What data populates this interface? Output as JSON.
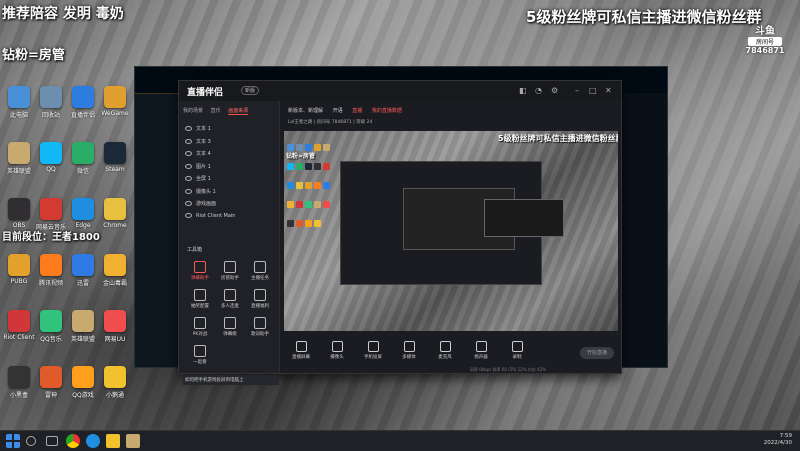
{
  "overlay": {
    "top_left": "推荐陪容 发明 毒奶",
    "left_mid": "钻粉=房管",
    "left_low": "目前段位：王者1800",
    "top_right": "5级粉丝牌可私信主播进微信粉丝群"
  },
  "room_badge": {
    "site": "斗鱼",
    "label": "房间号",
    "room": "7846871"
  },
  "desktop_icons": [
    {
      "label": "此电脑",
      "color": "#4a90d9"
    },
    {
      "label": "回收站",
      "color": "#6c8fb0"
    },
    {
      "label": "直播伴侣",
      "color": "#2d7de0"
    },
    {
      "label": "WeGame",
      "color": "#e0a030"
    },
    {
      "label": "英雄联盟",
      "color": "#c8aa6e"
    },
    {
      "label": "QQ",
      "color": "#12b7f5"
    },
    {
      "label": "微信",
      "color": "#2aae67"
    },
    {
      "label": "Steam",
      "color": "#1b2838"
    },
    {
      "label": "OBS",
      "color": "#302e31"
    },
    {
      "label": "网易云音乐",
      "color": "#d33a31"
    },
    {
      "label": "Edge",
      "color": "#1f8de0"
    },
    {
      "label": "Chrome",
      "color": "#e8c040"
    },
    {
      "label": "PUBG",
      "color": "#e3a02c"
    },
    {
      "label": "腾讯视频",
      "color": "#ff7c1e"
    },
    {
      "label": "迅雷",
      "color": "#2f7ae5"
    },
    {
      "label": "金山毒霸",
      "color": "#f0b030"
    },
    {
      "label": "Riot Client",
      "color": "#d13639"
    },
    {
      "label": "QQ音乐",
      "color": "#31c27c"
    },
    {
      "label": "英雄联盟",
      "color": "#c8aa6e"
    },
    {
      "label": "网易UU",
      "color": "#f04e4e"
    },
    {
      "label": "小黑盒",
      "color": "#333333"
    },
    {
      "label": "雷神",
      "color": "#e05a2a"
    },
    {
      "label": "QQ游戏",
      "color": "#ff9f1c"
    },
    {
      "label": "小鹅通",
      "color": "#f2c12e"
    }
  ],
  "app": {
    "title": "直播伴侣",
    "badge": "新版",
    "left_tabs": [
      "我的场景",
      "直乐",
      "画面来源"
    ],
    "sources": [
      "文本 1",
      "文本 3",
      "文本 4",
      "图片 1",
      "全屏 1",
      "摄像头 1",
      "游戏画面",
      "Riot Client Main"
    ],
    "tools_title": "工具箱",
    "tools": [
      "弹幕助手",
      "房管助手",
      "主播任务",
      "抽奖配置",
      "多人连麦",
      "直播福利",
      "PK对战",
      "弹幕姬",
      "歌词助手",
      "一起看"
    ],
    "bottom_tip": "如何把手机游戏投屏到电脑上",
    "main_tabs": [
      "新版本、新理解",
      "开语",
      "直播",
      "我的直播数据"
    ],
    "info": "Lol王者之路  |  房间号 7846871  |  等级 24",
    "controls": [
      "直播屏幕",
      "摄像头",
      "手机投屏",
      "多媒体",
      "麦克风",
      "扬声器",
      "录制"
    ],
    "start_button": "开始直播",
    "status": "码率 0kbps  帧率 60  CPU 12%  内存 42%"
  },
  "taskbar": {
    "time": "7:59",
    "date": "2022/4/30"
  }
}
